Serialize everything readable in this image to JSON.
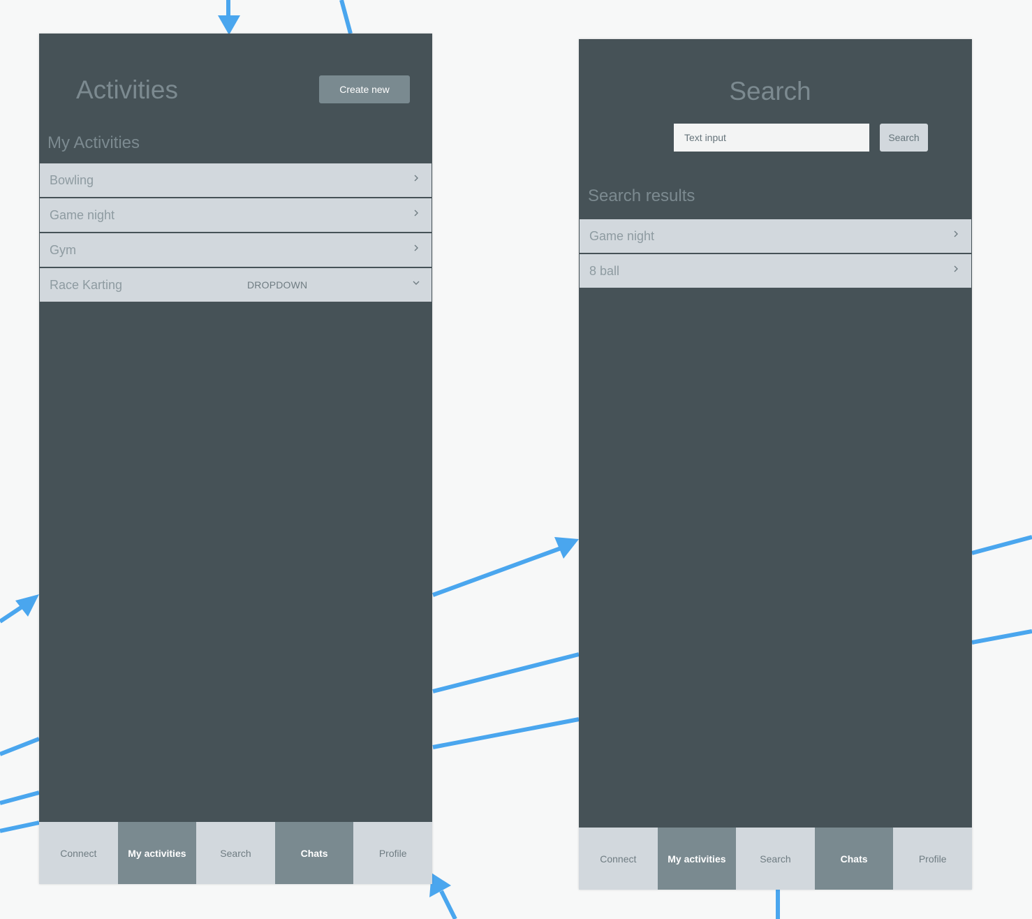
{
  "colors": {
    "canvas": "#f7f8f8",
    "screen_bg": "#465257",
    "row_bg": "#d2d8dd",
    "dark_button": "#7a8a90",
    "connector": "#4aa6ee"
  },
  "activities_screen": {
    "title": "Activities",
    "create_button": "Create new",
    "section_heading": "My Activities",
    "items": [
      {
        "label": "Bowling",
        "icon": "chevron-right-icon"
      },
      {
        "label": "Game night",
        "icon": "chevron-right-icon"
      },
      {
        "label": "Gym",
        "icon": "chevron-right-icon"
      },
      {
        "label": "Race Karting",
        "dropdown_label": "DROPDOWN",
        "icon": "chevron-down-icon"
      }
    ],
    "tabs": [
      "Connect",
      "My activities",
      "Search",
      "Chats",
      "Profile"
    ]
  },
  "search_screen": {
    "title": "Search",
    "input_placeholder": "Text input",
    "search_button": "Search",
    "section_heading": "Search results",
    "results": [
      {
        "label": "Game night",
        "icon": "chevron-right-icon"
      },
      {
        "label": "8 ball",
        "icon": "chevron-right-icon"
      }
    ],
    "tabs": [
      "Connect",
      "My activities",
      "Search",
      "Chats",
      "Profile"
    ]
  }
}
